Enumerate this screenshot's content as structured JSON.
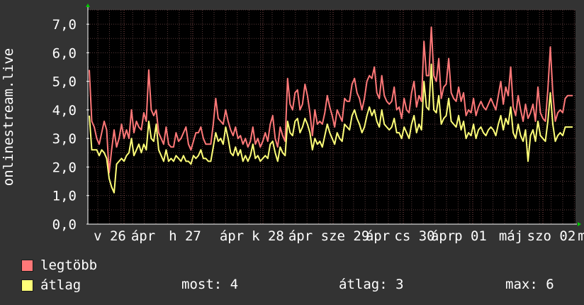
{
  "chart_data": {
    "type": "line",
    "ylabel": "onlinestream.live",
    "ylim": [
      0,
      7.5
    ],
    "y_ticks": [
      "0,0",
      "1,0",
      "2,0",
      "3,0",
      "4,0",
      "5,0",
      "6,0",
      "7,0"
    ],
    "x_tick_labels": [
      "v 26",
      "ápr",
      "h 27",
      "ápr",
      "k 28",
      "ápr",
      "sze 29",
      "ápr",
      "cs 30",
      "ápr",
      "p 01",
      "máj",
      "szo 02",
      "m"
    ],
    "grid": true,
    "background": "#000000",
    "grid_color": "#5a3b3b",
    "series": [
      {
        "name": "legtöbb",
        "color": "#ff7878",
        "values": [
          5.4,
          3.6,
          3.4,
          3.0,
          2.8,
          3.2,
          3.6,
          3.3,
          1.8,
          2.6,
          3.3,
          2.7,
          3.0,
          3.5,
          3.0,
          3.3,
          3.0,
          4.0,
          3.2,
          3.6,
          3.4,
          3.3,
          3.9,
          3.6,
          5.4,
          4.0,
          3.8,
          4.0,
          3.2,
          3.0,
          2.8,
          3.4,
          2.8,
          2.7,
          2.7,
          3.2,
          2.9,
          3.0,
          3.2,
          3.4,
          2.8,
          2.6,
          2.9,
          3.2,
          3.2,
          3.4,
          3.0,
          2.8,
          2.8,
          2.8,
          3.5,
          4.4,
          3.7,
          3.6,
          3.5,
          4.0,
          3.6,
          3.3,
          3.1,
          3.4,
          3.0,
          3.1,
          2.8,
          3.0,
          2.7,
          2.9,
          3.4,
          2.8,
          3.0,
          2.7,
          2.9,
          3.2,
          2.9,
          3.5,
          3.8,
          3.0,
          2.7,
          3.4,
          3.1,
          2.9,
          5.1,
          4.2,
          4.0,
          4.6,
          4.7,
          4.0,
          4.2,
          4.9,
          4.5,
          3.9,
          3.1,
          4.0,
          3.5,
          3.6,
          3.5,
          3.9,
          4.5,
          4.1,
          3.8,
          3.4,
          4.0,
          3.8,
          3.6,
          4.4,
          4.3,
          4.3,
          4.9,
          5.1,
          4.6,
          4.4,
          4.0,
          4.4,
          5.0,
          5.2,
          5.1,
          5.5,
          4.6,
          4.4,
          5.2,
          4.5,
          4.3,
          4.2,
          4.3,
          4.8,
          4.0,
          4.1,
          3.7,
          4.4,
          4.0,
          3.9,
          4.6,
          5.0,
          4.1,
          4.5,
          4.3,
          6.4,
          5.2,
          5.2,
          6.9,
          5.2,
          5.0,
          5.8,
          4.4,
          4.8,
          4.9,
          5.8,
          4.6,
          4.4,
          4.3,
          4.8,
          4.3,
          4.6,
          3.8,
          4.0,
          3.9,
          4.4,
          3.8,
          4.1,
          4.3,
          4.1,
          4.0,
          4.2,
          4.4,
          4.2,
          4.0,
          4.5,
          5.0,
          4.2,
          4.8,
          4.5,
          5.5,
          4.1,
          3.8,
          4.5,
          4.0,
          3.6,
          4.2,
          3.7,
          3.9,
          4.2,
          3.6,
          4.8,
          3.9,
          3.7,
          3.6,
          4.7,
          6.2,
          4.6,
          3.6,
          3.9,
          4.0,
          3.9,
          4.4,
          4.5,
          4.5,
          4.5
        ]
      },
      {
        "name": "átlag",
        "color": "#ffff78",
        "values": [
          3.8,
          2.6,
          2.6,
          2.6,
          2.4,
          2.6,
          2.5,
          2.3,
          1.6,
          1.3,
          1.1,
          2.1,
          2.2,
          2.3,
          2.2,
          2.4,
          2.5,
          3.0,
          2.4,
          2.6,
          2.8,
          2.5,
          2.8,
          2.6,
          3.6,
          3.0,
          2.9,
          3.5,
          2.6,
          2.4,
          2.2,
          2.6,
          2.2,
          2.3,
          2.2,
          2.4,
          2.3,
          2.2,
          2.4,
          2.2,
          2.2,
          2.1,
          2.4,
          2.3,
          2.4,
          2.6,
          2.3,
          2.3,
          2.2,
          2.2,
          2.7,
          3.2,
          2.9,
          3.0,
          2.8,
          3.4,
          3.0,
          2.5,
          2.4,
          2.7,
          2.4,
          2.6,
          2.2,
          2.4,
          2.2,
          2.4,
          2.8,
          2.3,
          2.4,
          2.2,
          2.3,
          2.4,
          2.3,
          2.8,
          2.9,
          2.5,
          2.2,
          2.7,
          2.5,
          2.4,
          3.6,
          3.2,
          3.1,
          3.6,
          3.7,
          3.2,
          3.4,
          3.7,
          3.5,
          3.2,
          2.6,
          3.0,
          2.8,
          2.9,
          2.7,
          3.1,
          3.5,
          3.2,
          3.0,
          2.8,
          3.2,
          3.0,
          2.9,
          3.5,
          3.4,
          3.3,
          3.8,
          4.0,
          3.7,
          3.5,
          3.2,
          3.4,
          3.8,
          4.1,
          3.8,
          4.0,
          3.6,
          3.4,
          4.0,
          3.5,
          3.4,
          3.3,
          3.4,
          3.7,
          3.2,
          3.2,
          3.0,
          3.4,
          3.2,
          3.0,
          3.5,
          3.8,
          3.2,
          3.5,
          3.3,
          5.0,
          4.1,
          4.0,
          5.6,
          4.0,
          3.9,
          4.5,
          3.5,
          3.7,
          3.8,
          4.4,
          3.6,
          3.5,
          3.4,
          3.8,
          3.3,
          3.6,
          3.0,
          3.2,
          3.1,
          3.5,
          3.0,
          3.3,
          3.4,
          3.2,
          3.1,
          3.3,
          3.4,
          3.3,
          3.1,
          3.5,
          3.8,
          3.3,
          3.7,
          3.5,
          4.1,
          3.2,
          3.0,
          3.5,
          3.1,
          2.9,
          3.3,
          2.2,
          3.1,
          3.3,
          2.9,
          3.6,
          3.1,
          3.0,
          2.9,
          3.6,
          4.6,
          3.5,
          2.9,
          3.1,
          3.2,
          3.1,
          3.4,
          3.4,
          3.4,
          3.4
        ]
      }
    ]
  },
  "legend": [
    {
      "label": "legtöbb",
      "color": "#ff7878"
    },
    {
      "label": "átlag",
      "color": "#ffff78"
    }
  ],
  "stats": {
    "most": "most: 4",
    "atlag": "átlag: 3",
    "max": "max: 6"
  }
}
